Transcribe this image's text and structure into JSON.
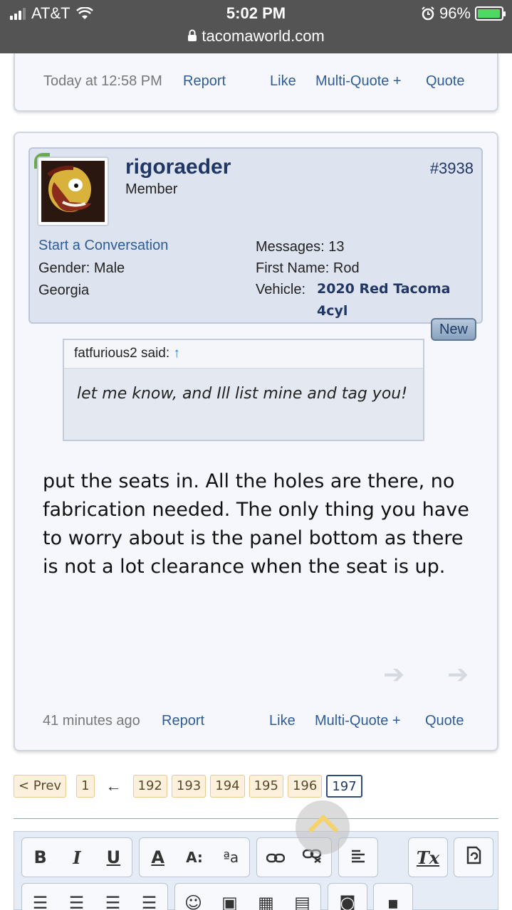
{
  "status_bar": {
    "carrier": "AT&T",
    "time": "5:02 PM",
    "url": "tacomaworld.com",
    "battery": "96%",
    "battery_level": 0.96
  },
  "previous_post": {
    "date": "Today at 12:58 PM",
    "report": "Report",
    "like": "Like",
    "multiquote": "Multi-Quote +",
    "quote": "Quote"
  },
  "post": {
    "username": "rigoraeder",
    "user_title": "Member",
    "post_number": "#3938",
    "start_conversation": "Start a Conversation",
    "gender_label": "Gender:",
    "gender_value": "Male",
    "location": "Georgia",
    "messages_label": "Messages:",
    "messages_value": "13",
    "first_name_label": "First Name:",
    "first_name_value": "Rod",
    "vehicle_label": "Vehicle:",
    "vehicle_value_line1": "2020 Red Tacoma",
    "vehicle_value_line2": "4cyl",
    "new_badge": "New",
    "quote_author": "fatfurious2 said:",
    "quote_arrow": "↑",
    "quote_text": "let me know, and Ill list mine and tag you!",
    "body": "put the seats in. All the holes are there, no fabrication needed. The only thing you have to worry about is the panel bottom as there is not a lot clearance when the seat is up.",
    "date": "41 minutes ago",
    "report": "Report",
    "like": "Like",
    "multiquote": "Multi-Quote +",
    "quote": "Quote"
  },
  "pagination": {
    "prev": "< Prev",
    "first": "1",
    "ellipsis": "←",
    "pages": [
      "192",
      "193",
      "194",
      "195",
      "196"
    ],
    "current": "197"
  },
  "editor_toolbar": {
    "bold": "B",
    "italic": "I",
    "underline": "U",
    "font_color": "A",
    "font_size": "A:",
    "font_case": "ªa",
    "remove_format": "Tx"
  },
  "colors": {
    "status_bar_bg": "#545454",
    "post_bg": "#f5f7fc",
    "userbox_bg": "#dde3ef",
    "link": "#2e5c99",
    "username": "#203766"
  }
}
